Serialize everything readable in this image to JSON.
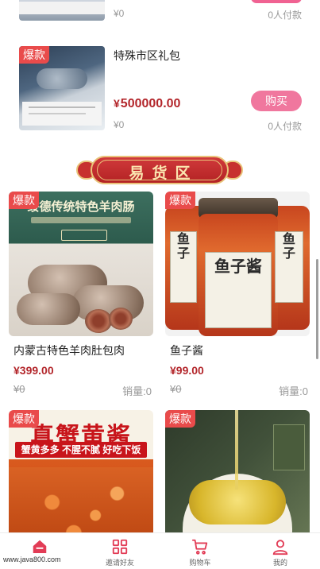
{
  "top_partial": {
    "price": "¥0",
    "buyers": "0人付款"
  },
  "featured_product": {
    "badge": "爆款",
    "title": "特殊市区礼包",
    "currency": "¥",
    "price": "500000.00",
    "buy_label": "购买",
    "original_price": "¥0",
    "buyers": "0人付款"
  },
  "section": {
    "title": "易货区"
  },
  "products": [
    {
      "badge": "爆款",
      "image_text": "绥德传统特色羊肉肠",
      "name": "内蒙古特色羊肉肚包肉",
      "price": "¥399.00",
      "original_price": "¥0",
      "sales": "销量:0"
    },
    {
      "badge": "爆款",
      "image_text": "鱼子酱",
      "name": "鱼子酱",
      "price": "¥99.00",
      "original_price": "¥0",
      "sales": "销量:0"
    },
    {
      "badge": "爆款",
      "image_text": "真蟹黄酱",
      "image_subtext": "蟹黄多多 不腥不腻 好吃下饭"
    },
    {
      "badge": "爆款"
    }
  ],
  "tabbar": {
    "items": [
      {
        "label": "",
        "icon": "home-icon",
        "active": true
      },
      {
        "label": "邀请好友",
        "icon": "grid-icon",
        "active": false
      },
      {
        "label": "购物车",
        "icon": "cart-icon",
        "active": false
      },
      {
        "label": "我的",
        "icon": "user-icon",
        "active": false
      }
    ]
  },
  "watermark": "www.java800.com",
  "colors": {
    "accent": "#e23c56",
    "badge": "#e94b4b",
    "price": "#b3262b",
    "buy_button": "#f0779e"
  }
}
